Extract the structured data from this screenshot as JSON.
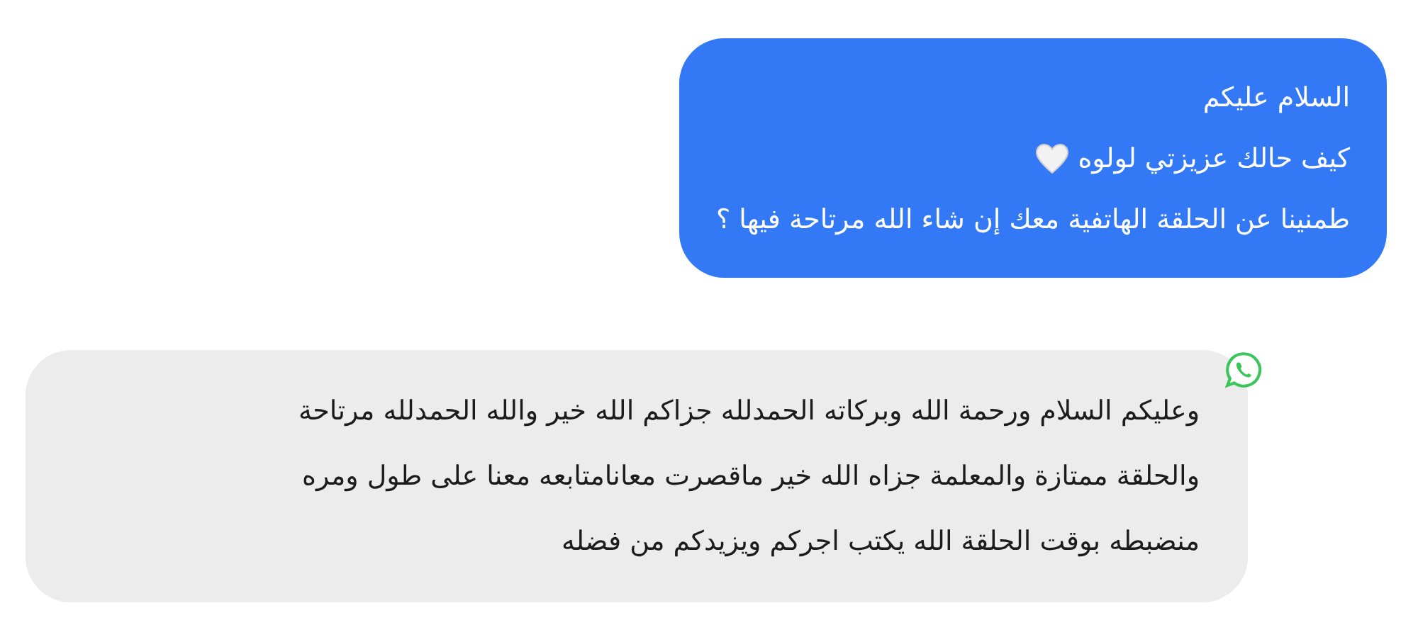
{
  "messages": [
    {
      "kind": "sent",
      "lines": [
        "السلام عليكم",
        "كيف حالك عزيزتي لولوه",
        "طمنينا عن الحلقة الهاتفية معك إن شاء الله مرتاحة فيها ؟"
      ]
    },
    {
      "kind": "received",
      "lines": [
        "وعليكم السلام ورحمة الله وبركاته الحمدلله جزاكم الله خير والله الحمدلله مرتاحة",
        "والحلقة ممتازة والمعلمة جزاه الله خير ماقصرت معانامتابعه معنا على طول ومره",
        "منضبطه بوقت الحلقة الله يكتب اجركم ويزيدكم من فضله"
      ]
    }
  ]
}
